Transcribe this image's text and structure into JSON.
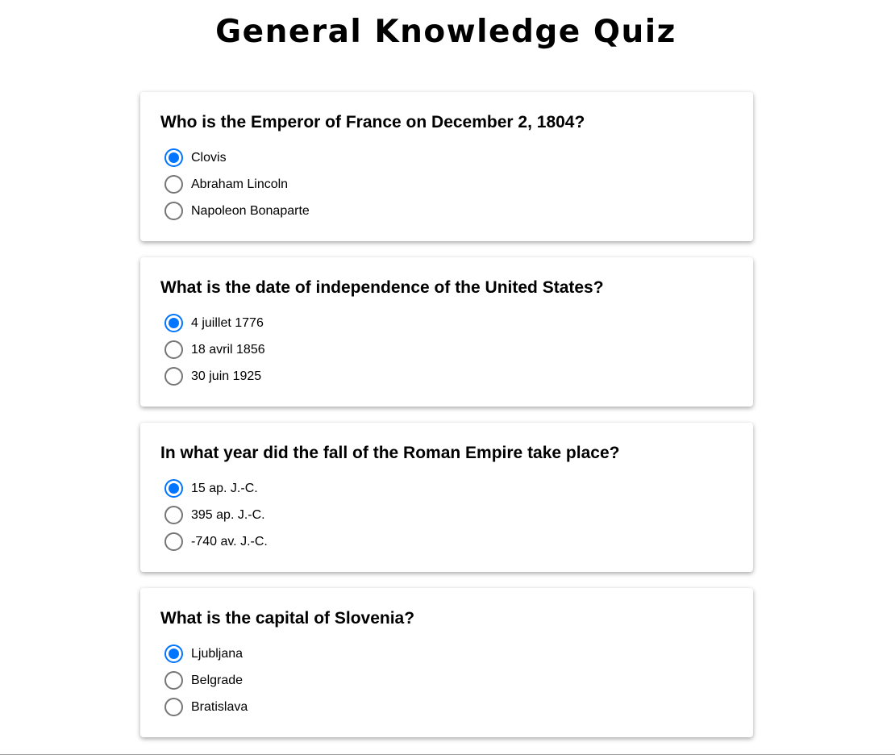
{
  "page": {
    "title": "General Knowledge Quiz"
  },
  "accent_color": "#0075ff",
  "questions": [
    {
      "text": "Who is the Emperor of France on December 2, 1804?",
      "options": [
        "Clovis",
        "Abraham Lincoln",
        "Napoleon Bonaparte"
      ],
      "selected_index": 0
    },
    {
      "text": "What is the date of independence of the United States?",
      "options": [
        "4 juillet 1776",
        "18 avril 1856",
        "30 juin 1925"
      ],
      "selected_index": 0
    },
    {
      "text": "In what year did the fall of the Roman Empire take place?",
      "options": [
        "15 ap. J.-C.",
        "395 ap. J.-C.",
        "-740 av. J.-C."
      ],
      "selected_index": 0
    },
    {
      "text": "What is the capital of Slovenia?",
      "options": [
        "Ljubljana",
        "Belgrade",
        "Bratislava"
      ],
      "selected_index": 0
    }
  ]
}
